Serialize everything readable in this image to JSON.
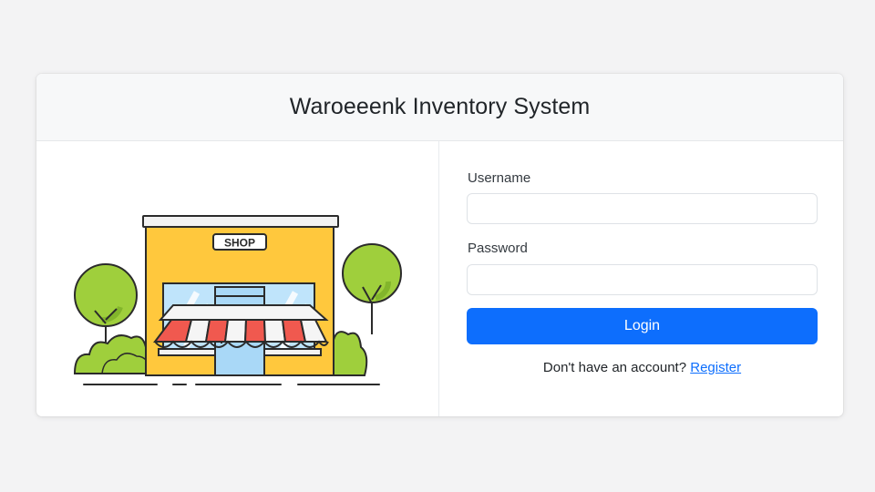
{
  "header": {
    "title": "Waroeeenk Inventory System"
  },
  "illustration": {
    "shop_sign": "SHOP",
    "icon": "storefront-illustration"
  },
  "form": {
    "username_label": "Username",
    "username_value": "",
    "password_label": "Password",
    "password_value": "",
    "login_label": "Login"
  },
  "footer": {
    "prompt_text": "Don't have an account?",
    "register_label": "Register"
  },
  "colors": {
    "primary": "#0d6efd",
    "header_bg": "#f7f8f9",
    "page_bg": "#f3f3f4",
    "shop_wall": "#ffc83d",
    "awning_red": "#f0594f",
    "tree_green": "#9fcf3c"
  }
}
